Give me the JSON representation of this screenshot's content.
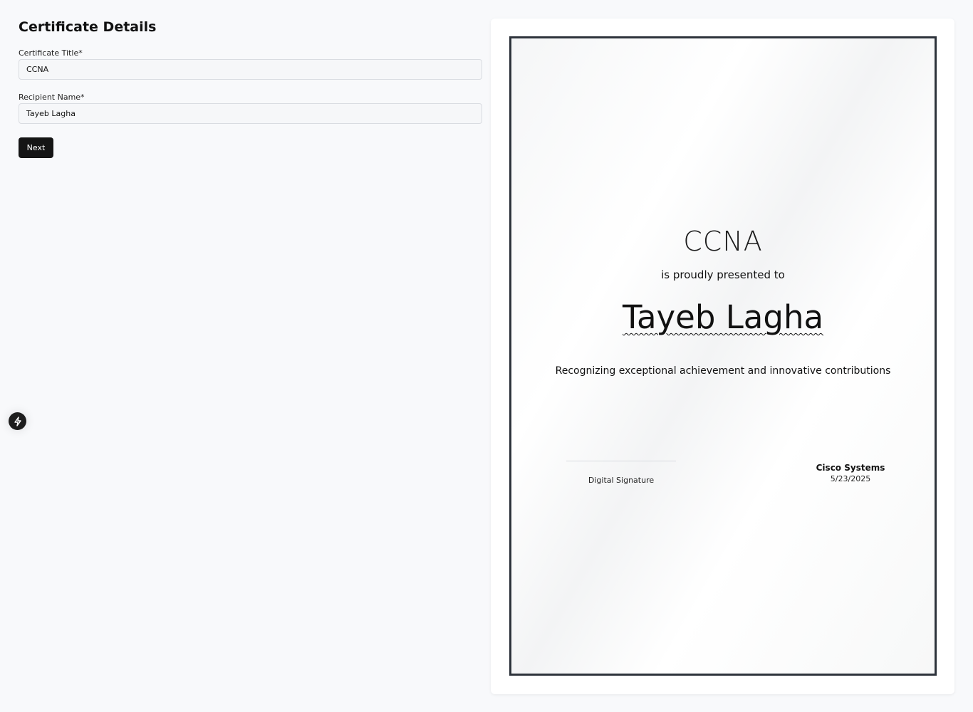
{
  "form": {
    "heading": "Certificate Details",
    "title_label": "Certificate Title*",
    "title_value": "CCNA",
    "recipient_label": "Recipient Name*",
    "recipient_value": "Tayeb Lagha",
    "next_label": "Next"
  },
  "floating_action": {
    "icon": "lightning-bolt-icon"
  },
  "certificate": {
    "title": "CCNA",
    "presented_text": "is proudly presented to",
    "recipient": "Tayeb Lagha",
    "description": "Recognizing exceptional achievement and innovative contributions",
    "signature_label": "Digital Signature",
    "issuer": "Cisco Systems",
    "date": "5/23/2025"
  },
  "colors": {
    "page_background": "#f8f9fb",
    "button_background": "#151515",
    "certificate_border": "#2d333b"
  }
}
